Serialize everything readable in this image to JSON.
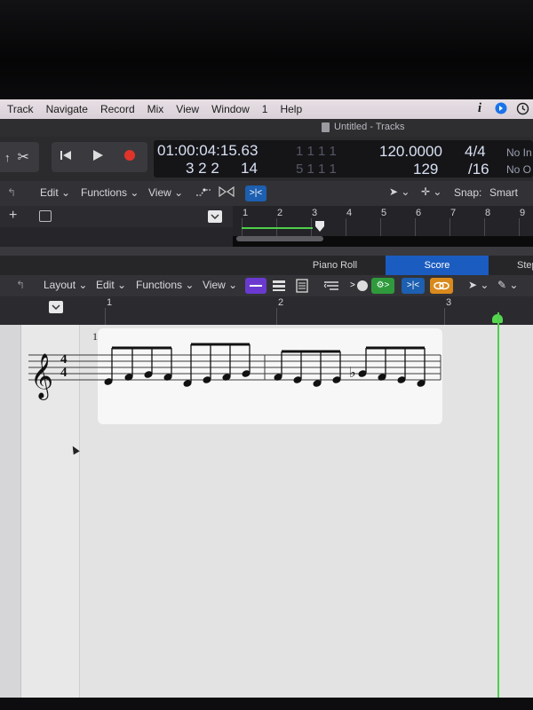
{
  "menubar": {
    "items": [
      "Track",
      "Navigate",
      "Record",
      "Mix",
      "View",
      "Window",
      "1",
      "Help"
    ],
    "icons": [
      "info-icon",
      "shield-status-icon",
      "time-machine-icon"
    ]
  },
  "window": {
    "title": "Untitled - Tracks"
  },
  "transport": {
    "smpte": "01:00:04:15.63",
    "bars_beats": "3  2  2",
    "ticks": "14",
    "locator_top": "1   1   1         1",
    "locator_bottom": "5   1   1         1",
    "tempo": "120.0000",
    "tempo_sub": "129",
    "time_signature": "4/4",
    "division": "/16",
    "no_in": "No In",
    "no_out": "No O"
  },
  "tracks_toolbar": {
    "edit": "Edit",
    "functions": "Functions",
    "view": "View",
    "snap_label": "Snap:",
    "snap_value": "Smart"
  },
  "tracks_ruler": [
    "1",
    "2",
    "3",
    "4",
    "5",
    "6",
    "7",
    "8",
    "9"
  ],
  "editor_tabs": {
    "piano_roll": "Piano Roll",
    "score": "Score",
    "step": "Step"
  },
  "score_toolbar": {
    "layout": "Layout",
    "edit": "Edit",
    "functions": "Functions",
    "view": "View"
  },
  "score_ruler": [
    "1",
    "2",
    "3"
  ],
  "score": {
    "measure_number": "1",
    "time_signature_top": "4",
    "time_signature_bottom": "4"
  },
  "colors": {
    "accent_blue": "#1b5cc0",
    "playhead_green": "#4fcf4a",
    "record_red": "#e0342b",
    "purple_button": "#6a3ad0",
    "green_button": "#2f9a3c",
    "orange_button": "#d98a1c"
  }
}
